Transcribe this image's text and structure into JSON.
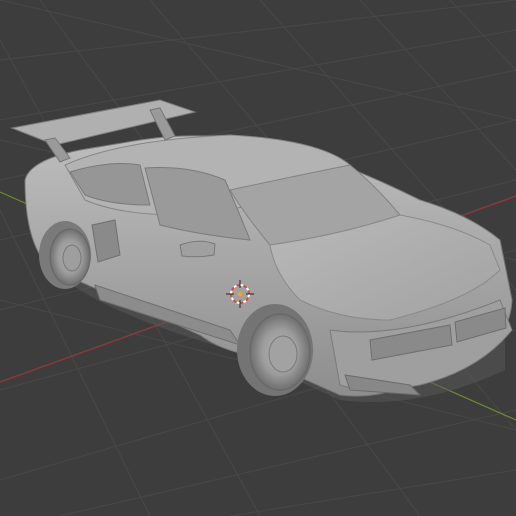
{
  "viewport": {
    "background_color": "#3d3d3d",
    "grid_color": "#484848",
    "x_axis_color": "#8a3a3a",
    "y_axis_color": "#6e8a2e",
    "model_color": "#a7a7a7"
  },
  "scene": {
    "object": "sports-car-model",
    "shading": "solid",
    "view": "perspective"
  },
  "gizmo": {
    "icon": "3d-cursor-icon"
  }
}
